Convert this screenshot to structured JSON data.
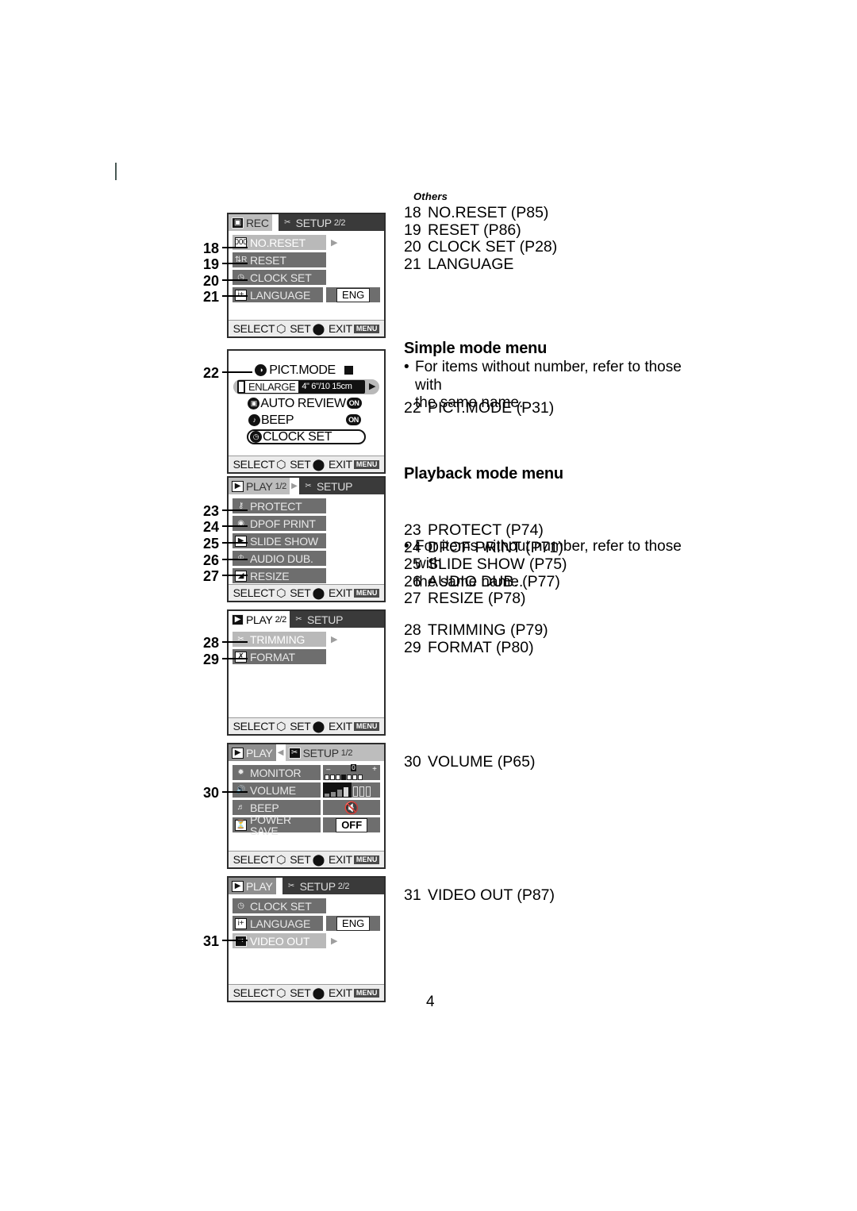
{
  "page": {
    "number": "4",
    "section_label": "Others"
  },
  "right_column": {
    "list_others": [
      {
        "num": "18",
        "text": "NO.RESET (P85)"
      },
      {
        "num": "19",
        "text": "RESET (P86)"
      },
      {
        "num": "20",
        "text": "CLOCK SET (P28)"
      },
      {
        "num": "21",
        "text": "LANGUAGE"
      }
    ],
    "simple": {
      "heading": "Simple mode menu",
      "note_line1": "For items without number, refer to those with",
      "note_line2": "the same name.",
      "items": [
        {
          "num": "22",
          "text": "PICT.MODE (P31)"
        }
      ]
    },
    "playback": {
      "heading": "Playback mode menu",
      "note_line1": "For items without number, refer to those with",
      "note_line2": "the same name.",
      "group1": [
        {
          "num": "23",
          "text": "PROTECT (P74)"
        },
        {
          "num": "24",
          "text": "DPOF PRINT (P71)"
        },
        {
          "num": "25",
          "text": "SLIDE SHOW (P75)"
        },
        {
          "num": "26",
          "text": "AUDIO DUB. (P77)"
        },
        {
          "num": "27",
          "text": "RESIZE (P78)"
        }
      ],
      "group2": [
        {
          "num": "28",
          "text": "TRIMMING (P79)"
        },
        {
          "num": "29",
          "text": "FORMAT (P80)"
        }
      ],
      "group3": [
        {
          "num": "30",
          "text": "VOLUME (P65)"
        }
      ],
      "group4": [
        {
          "num": "31",
          "text": "VIDEO OUT (P87)"
        }
      ]
    }
  },
  "footer_bar": {
    "select": "SELECT",
    "set": "SET",
    "exit": "EXIT",
    "menu_chip": "MENU"
  },
  "screens": {
    "rec_setup2": {
      "tabs": [
        {
          "label": "REC",
          "icon": "camera-icon",
          "page": ""
        },
        {
          "label": "SETUP",
          "icon": "wrench-icon",
          "page": "2/2"
        }
      ],
      "rows": [
        {
          "label": "NO.RESET",
          "icon": "counter-icon",
          "selected": true,
          "arrow": true,
          "value": ""
        },
        {
          "label": "RESET",
          "icon": "reset-icon",
          "selected": false,
          "arrow": false,
          "value": ""
        },
        {
          "label": "CLOCK SET",
          "icon": "clock-icon",
          "selected": false,
          "arrow": false,
          "value": ""
        },
        {
          "label": "LANGUAGE",
          "icon": "language-icon",
          "selected": false,
          "arrow": false,
          "value": "ENG"
        }
      ],
      "leaders": [
        "18",
        "19",
        "20",
        "21"
      ]
    },
    "simple": {
      "title": "PICT.MODE",
      "enlarge_label": "ENLARGE",
      "enlarge_values": "4\"  6\"/10  15cm",
      "rows": [
        {
          "label": "AUTO REVIEW",
          "icon": "review-icon",
          "value": "ON"
        },
        {
          "label": "BEEP",
          "icon": "beep-icon",
          "value": "ON"
        },
        {
          "label": "CLOCK SET",
          "icon": "clock-icon",
          "value": ""
        }
      ],
      "leader": "22"
    },
    "play1": {
      "tabs": [
        {
          "label": "PLAY",
          "icon": "play-icon",
          "page": "1/2"
        },
        {
          "label": "SETUP",
          "icon": "wrench-icon",
          "page": ""
        }
      ],
      "rows": [
        {
          "label": "PROTECT",
          "icon": "key-icon",
          "selected": false
        },
        {
          "label": "DPOF PRINT",
          "icon": "print-icon",
          "selected": false
        },
        {
          "label": "SLIDE SHOW",
          "icon": "slides-icon",
          "selected": false
        },
        {
          "label": "AUDIO DUB.",
          "icon": "mic-icon",
          "selected": false
        },
        {
          "label": "RESIZE",
          "icon": "resize-icon",
          "selected": false
        }
      ],
      "leaders": [
        "23",
        "24",
        "25",
        "26",
        "27"
      ]
    },
    "play2": {
      "tabs": [
        {
          "label": "PLAY",
          "icon": "play-icon",
          "page": "2/2"
        },
        {
          "label": "SETUP",
          "icon": "wrench-icon",
          "page": ""
        }
      ],
      "rows": [
        {
          "label": "TRIMMING",
          "icon": "scissors-icon",
          "selected": true,
          "arrow": true
        },
        {
          "label": "FORMAT",
          "icon": "format-icon",
          "selected": false,
          "arrow": false
        }
      ],
      "leaders": [
        "28",
        "29"
      ]
    },
    "setup1": {
      "tabs": [
        {
          "label": "PLAY",
          "icon": "play-icon",
          "page": ""
        },
        {
          "label": "SETUP",
          "icon": "wrench-icon",
          "page": "1/2"
        }
      ],
      "rows": [
        {
          "label": "MONITOR",
          "icon": "brightness-icon",
          "value_kind": "monitor-scale",
          "minus": "–",
          "zero": "0",
          "plus": "+"
        },
        {
          "label": "VOLUME",
          "icon": "speaker-icon",
          "value_kind": "volume-bars"
        },
        {
          "label": "BEEP",
          "icon": "beep-icon",
          "value_kind": "beep-mute-icon"
        },
        {
          "label": "POWER SAVE",
          "icon": "powersave-icon",
          "value_kind": "chip",
          "value": "OFF"
        }
      ],
      "leaders": [
        "30"
      ]
    },
    "setup2": {
      "tabs": [
        {
          "label": "PLAY",
          "icon": "play-icon",
          "page": ""
        },
        {
          "label": "SETUP",
          "icon": "wrench-icon",
          "page": "2/2"
        }
      ],
      "rows": [
        {
          "label": "CLOCK SET",
          "icon": "clock-icon",
          "selected": false,
          "arrow": false,
          "value": ""
        },
        {
          "label": "LANGUAGE",
          "icon": "language-icon",
          "selected": false,
          "arrow": false,
          "value": "ENG"
        },
        {
          "label": "VIDEO OUT",
          "icon": "videoout-icon",
          "selected": true,
          "arrow": true,
          "value": ""
        }
      ],
      "leaders": [
        "31"
      ]
    }
  }
}
